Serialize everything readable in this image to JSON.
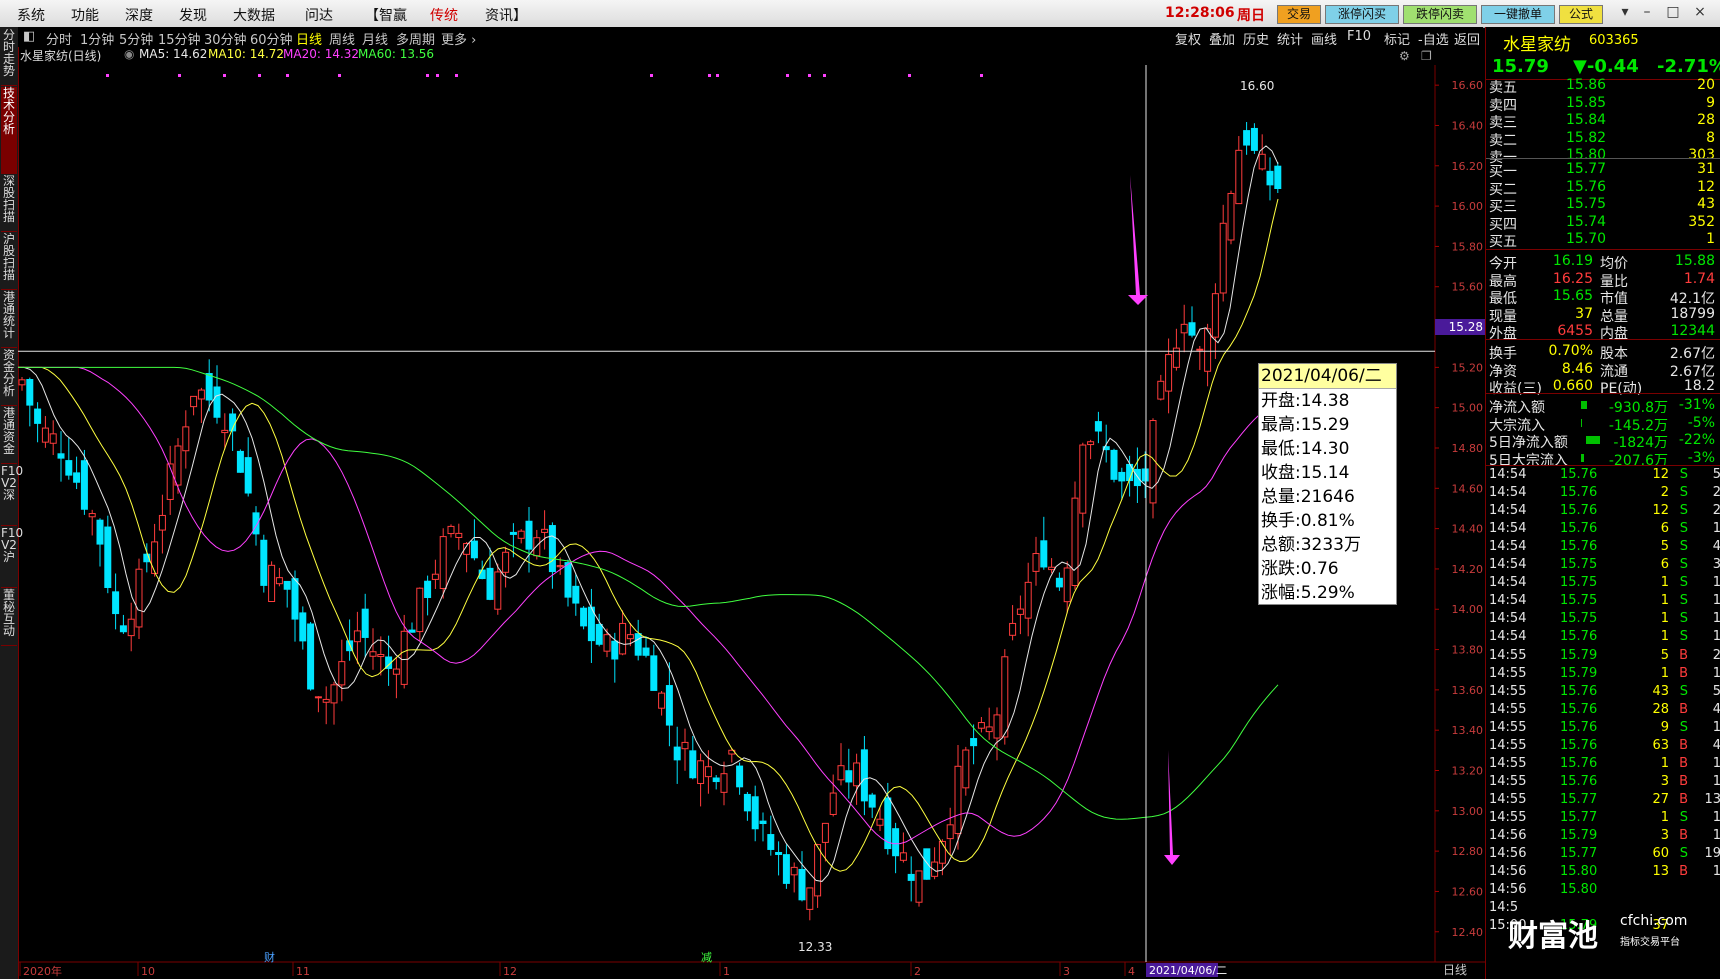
{
  "menu": {
    "items": [
      "系统",
      "功能",
      "深度",
      "发现",
      "大数据",
      "问达",
      "【智赢",
      "传统",
      "资讯】"
    ],
    "clock": "12:28:06",
    "weekday": "周日",
    "buttons": [
      "交易",
      "涨停闪买",
      "跌停闪卖",
      "一键撤单",
      "公式"
    ]
  },
  "left_tabs": [
    "分时走势",
    "技术分析",
    "深股扫描",
    "沪股扫描",
    "港通统计",
    "资金分析",
    "港通资金",
    "F10 V2深",
    "F10 V2沪",
    "董秘互动"
  ],
  "periods": [
    "分时",
    "1分钟",
    "5分钟",
    "15分钟",
    "30分钟",
    "60分钟",
    "日线",
    "周线",
    "月线",
    "多周期",
    "更多 ›"
  ],
  "active_period": "日线",
  "tools": [
    "复权",
    "叠加",
    "历史",
    "统计",
    "画线",
    "F10",
    "标记",
    "-自选",
    "返回"
  ],
  "ma_bar": {
    "title": "水星家纺(日线)",
    "ma5": "MA5: 14.62",
    "ma10": "MA10: 14.72",
    "ma20": "MA20: 14.32",
    "ma60": "MA60: 13.56"
  },
  "chart_data": {
    "type": "candlestick",
    "ylim": [
      12.25,
      16.7
    ],
    "y_ticks": [
      "16.60",
      "16.40",
      "16.20",
      "16.00",
      "15.80",
      "15.60",
      "15.40",
      "15.20",
      "15.00",
      "14.80",
      "14.60",
      "14.40",
      "14.20",
      "14.00",
      "13.80",
      "13.60",
      "13.40",
      "13.20",
      "13.00",
      "12.80",
      "12.60",
      "12.40"
    ],
    "x_labels": [
      "2020年",
      "10",
      "11",
      "12",
      "1",
      "2",
      "3",
      "4"
    ],
    "cursor_price": "15.28",
    "max_label": "16.60",
    "min_label": "12.33",
    "markers": [
      "财",
      "减"
    ],
    "cursor_date_label": "2021/04/06/二",
    "right_axis_label": "日线"
  },
  "tooltip": {
    "date": "2021/04/06/二",
    "rows": [
      "开盘:14.38",
      "最高:15.29",
      "最低:14.30",
      "收盘:15.14",
      "总量:21646",
      "换手:0.81%",
      "总额:3233万",
      "涨跌:0.76",
      "涨幅:5.29%"
    ]
  },
  "quote": {
    "name": "水星家纺",
    "code": "603365",
    "price": "15.79",
    "change": "▼-0.44",
    "pct": "-2.71%",
    "asks": [
      {
        "label": "卖五",
        "price": "15.86",
        "vol": "20"
      },
      {
        "label": "卖四",
        "price": "15.85",
        "vol": "9"
      },
      {
        "label": "卖三",
        "price": "15.84",
        "vol": "28"
      },
      {
        "label": "卖二",
        "price": "15.82",
        "vol": "8"
      },
      {
        "label": "卖一",
        "price": "15.80",
        "vol": "303"
      }
    ],
    "bids": [
      {
        "label": "买一",
        "price": "15.77",
        "vol": "31"
      },
      {
        "label": "买二",
        "price": "15.76",
        "vol": "12"
      },
      {
        "label": "买三",
        "price": "15.75",
        "vol": "43"
      },
      {
        "label": "买四",
        "price": "15.74",
        "vol": "352"
      },
      {
        "label": "买五",
        "price": "15.70",
        "vol": "1"
      }
    ],
    "stats1": [
      {
        "l1": "今开",
        "v1": "16.19",
        "l2": "均价",
        "v2": "15.88"
      },
      {
        "l1": "最高",
        "v1": "16.25",
        "l2": "量比",
        "v2": "1.74"
      },
      {
        "l1": "最低",
        "v1": "15.65",
        "l2": "市值",
        "v2": "42.1亿"
      },
      {
        "l1": "现量",
        "v1": "37",
        "l2": "总量",
        "v2": "18799"
      },
      {
        "l1": "外盘",
        "v1": "6455",
        "l2": "内盘",
        "v2": "12344"
      }
    ],
    "stats2": [
      {
        "l1": "换手",
        "v1": "0.70%",
        "l2": "股本",
        "v2": "2.67亿"
      },
      {
        "l1": "净资",
        "v1": "8.46",
        "l2": "流通",
        "v2": "2.67亿"
      },
      {
        "l1": "收益(三)",
        "v1": "0.660",
        "l2": "PE(动)",
        "v2": "18.2"
      }
    ],
    "flows": [
      {
        "label": "净流入额",
        "value": "-930.8万",
        "pct": "-31%"
      },
      {
        "label": "大宗流入",
        "value": "-145.2万",
        "pct": "-5%"
      },
      {
        "label": "5日净流入额",
        "value": "-1824万",
        "pct": "-22%"
      },
      {
        "label": "5日大宗流入",
        "value": "-207.6万",
        "pct": "-3%"
      }
    ],
    "ticks": [
      {
        "t": "14:54",
        "p": "15.76",
        "v": "12",
        "s": "S",
        "n": "5"
      },
      {
        "t": "14:54",
        "p": "15.76",
        "v": "2",
        "s": "S",
        "n": "2"
      },
      {
        "t": "14:54",
        "p": "15.76",
        "v": "12",
        "s": "S",
        "n": "2"
      },
      {
        "t": "14:54",
        "p": "15.76",
        "v": "6",
        "s": "S",
        "n": "1"
      },
      {
        "t": "14:54",
        "p": "15.76",
        "v": "5",
        "s": "S",
        "n": "4"
      },
      {
        "t": "14:54",
        "p": "15.75",
        "v": "6",
        "s": "S",
        "n": "3"
      },
      {
        "t": "14:54",
        "p": "15.75",
        "v": "1",
        "s": "S",
        "n": "1"
      },
      {
        "t": "14:54",
        "p": "15.75",
        "v": "1",
        "s": "S",
        "n": "1"
      },
      {
        "t": "14:54",
        "p": "15.75",
        "v": "1",
        "s": "S",
        "n": "1"
      },
      {
        "t": "14:54",
        "p": "15.76",
        "v": "1",
        "s": "S",
        "n": "1"
      },
      {
        "t": "14:55",
        "p": "15.79",
        "v": "5",
        "s": "B",
        "n": "2"
      },
      {
        "t": "14:55",
        "p": "15.79",
        "v": "1",
        "s": "B",
        "n": "1"
      },
      {
        "t": "14:55",
        "p": "15.76",
        "v": "43",
        "s": "S",
        "n": "5"
      },
      {
        "t": "14:55",
        "p": "15.76",
        "v": "28",
        "s": "B",
        "n": "4"
      },
      {
        "t": "14:55",
        "p": "15.76",
        "v": "9",
        "s": "S",
        "n": "1"
      },
      {
        "t": "14:55",
        "p": "15.76",
        "v": "63",
        "s": "B",
        "n": "4"
      },
      {
        "t": "14:55",
        "p": "15.76",
        "v": "1",
        "s": "B",
        "n": "1"
      },
      {
        "t": "14:55",
        "p": "15.76",
        "v": "3",
        "s": "B",
        "n": "1"
      },
      {
        "t": "14:55",
        "p": "15.77",
        "v": "27",
        "s": "B",
        "n": "13"
      },
      {
        "t": "14:55",
        "p": "15.77",
        "v": "1",
        "s": "S",
        "n": "1"
      },
      {
        "t": "14:56",
        "p": "15.79",
        "v": "3",
        "s": "B",
        "n": "1"
      },
      {
        "t": "14:56",
        "p": "15.77",
        "v": "60",
        "s": "S",
        "n": "19"
      },
      {
        "t": "14:56",
        "p": "15.80",
        "v": "13",
        "s": "B",
        "n": "1"
      },
      {
        "t": "14:56",
        "p": "15.80",
        "v": "",
        "s": "",
        "n": ""
      },
      {
        "t": "14:5",
        "p": "",
        "v": "",
        "s": "",
        "n": ""
      },
      {
        "t": "15:00",
        "p": "15.79",
        "v": "37",
        "s": "",
        "n": ""
      }
    ]
  },
  "watermark": {
    "brand": "财富池",
    "url": "cfchi.com",
    "tagline": "指标交易平台"
  }
}
